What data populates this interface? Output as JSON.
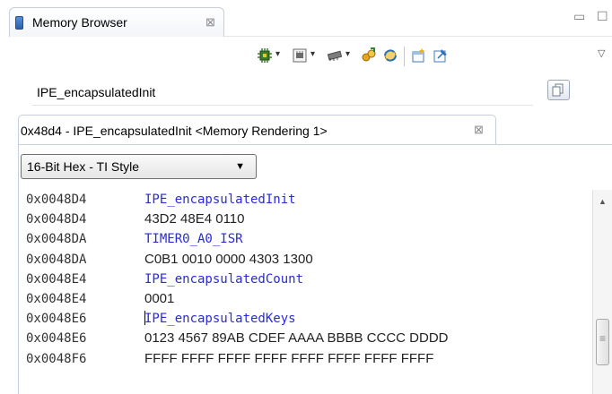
{
  "view_tab": {
    "title": "Memory Browser",
    "close_glyph": "⊠",
    "minimize_glyph": "▭",
    "maximize_glyph": "☐"
  },
  "toolbar": {
    "dropdown_glyph": "▾",
    "view_menu_glyph": "▽",
    "icons": [
      "new-memory-monitor-icon",
      "memory-rendering-icon",
      "load-memory-icon",
      "import-icon",
      "refresh-icon",
      "new-tab-icon",
      "pin-icon"
    ]
  },
  "address": {
    "value": "IPE_encapsulatedInit"
  },
  "rendering_tab": {
    "title": "0x48d4 - IPE_encapsulatedInit <Memory Rendering 1>",
    "close_glyph": "⊠"
  },
  "format": {
    "selected": "16-Bit Hex - TI Style",
    "caret": "▼"
  },
  "memory_rows": [
    {
      "address": "0x0048D4",
      "content": "IPE_encapsulatedInit",
      "kind": "symbol"
    },
    {
      "address": "0x0048D4",
      "content": "43D2 48E4 0110",
      "kind": "data"
    },
    {
      "address": "0x0048DA",
      "content": "TIMER0_A0_ISR",
      "kind": "symbol"
    },
    {
      "address": "0x0048DA",
      "content": "C0B1 0010 0000 4303 1300",
      "kind": "data"
    },
    {
      "address": "0x0048E4",
      "content": "IPE_encapsulatedCount",
      "kind": "symbol"
    },
    {
      "address": "0x0048E4",
      "content": "0001",
      "kind": "data"
    },
    {
      "address": "0x0048E6",
      "content": "IPE_encapsulatedKeys",
      "kind": "symbol"
    },
    {
      "address": "0x0048E6",
      "content": "0123 4567 89AB CDEF AAAA BBBB CCCC DDDD",
      "kind": "data"
    },
    {
      "address": "0x0048F6",
      "content": "FFFF FFFF FFFF FFFF FFFF FFFF FFFF FFFF",
      "kind": "data"
    }
  ],
  "scrollbar": {
    "up_glyph": "▲",
    "grip_glyph": "≡"
  },
  "colors": {
    "symbol": "#2a2ad8",
    "tab_border": "#c7cfdb"
  }
}
